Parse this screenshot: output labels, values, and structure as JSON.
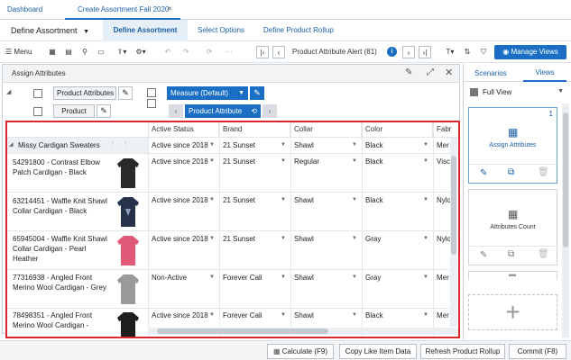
{
  "tabs": {
    "dashboard": "Dashboard",
    "active": "Create Assortment Fall 2020",
    "close": "×"
  },
  "steps": {
    "workflow": "Define Assortment",
    "current": "Define Assortment",
    "options": "Select Options",
    "rollup": "Define Product Rollup"
  },
  "toolbar": {
    "menu": "Menu",
    "alert": "Product Attribute Alert (81)",
    "manage": "Manage Views"
  },
  "panel": {
    "title": "Assign Attributes",
    "row_tile1": "Product Attributes",
    "row_tile2": "Product",
    "measure": "Measure (Default)",
    "product_attr": "Product Attribute"
  },
  "grid": {
    "group_label": "Missy Cardigan Sweaters",
    "headers": [
      "Active Status",
      "Brand",
      "Collar",
      "Color",
      "Fabr"
    ],
    "group_values": [
      "Active since 2018",
      "21 Sunset",
      "Shawl",
      "Black",
      "Mer"
    ],
    "rows": [
      {
        "name": "54291800 - Contrast Elbow Patch Cardigan - Black",
        "color_hex": "#2a2a2a",
        "values": [
          "Active since 2018",
          "21 Sunset",
          "Regular",
          "Black",
          "Visc"
        ]
      },
      {
        "name": "63214451 - Waffle Knit Shawl Collar Cardigan - Black",
        "color_hex": "#26324a",
        "values": [
          "Active since 2018",
          "21 Sunset",
          "Shawl",
          "Black",
          "Nylo"
        ]
      },
      {
        "name": "65945004 - Waffle Knit Shawl Collar Cardigan - Pearl Heather",
        "color_hex": "#e05a78",
        "values": [
          "Active since 2018",
          "21 Sunset",
          "Shawl",
          "Gray",
          "Nylo"
        ]
      },
      {
        "name": "77316938 - Angled Front Merino Wool Cardigan - Grey",
        "color_hex": "#9a9a9a",
        "values": [
          "Non-Active",
          "Forever Cali",
          "Shawl",
          "Gray",
          "Mer"
        ]
      },
      {
        "name": "78498351 - Angled Front Merino Wool Cardigan -",
        "color_hex": "#1e1e1e",
        "values": [
          "Active since 2018",
          "Forever Cali",
          "Shawl",
          "Black",
          "Mer"
        ]
      }
    ]
  },
  "right": {
    "tab_scenarios": "Scenarios",
    "tab_views": "Views",
    "view_select": "Full View",
    "card1_num": "1",
    "card1_label": "Assign Attributes",
    "card2_label": "Attributes Count"
  },
  "bottom": {
    "calculate": "Calculate (F9)",
    "copy": "Copy Like Item Data",
    "refresh": "Refresh Product Rollup",
    "commit": "Commit (F8)"
  },
  "colors": {
    "accent": "#1a6fc4",
    "highlight": "#d9262f"
  }
}
